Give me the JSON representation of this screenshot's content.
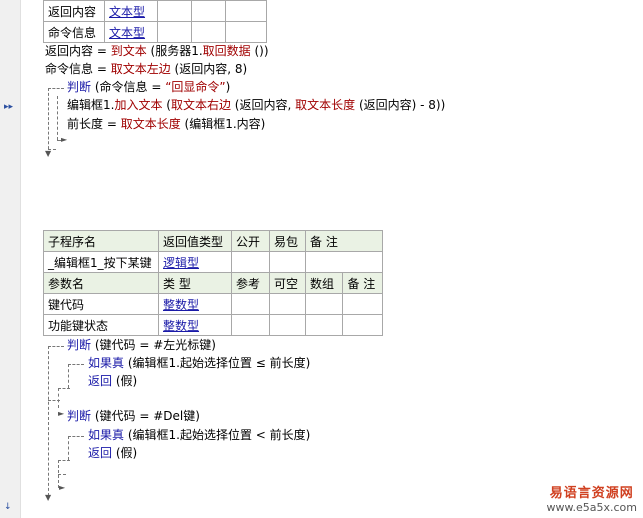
{
  "top_table": [
    {
      "name": "返回内容",
      "type": "文本型"
    },
    {
      "name": "命令信息",
      "type": "文本型"
    }
  ],
  "code1": {
    "l1": {
      "a": "返回内容 = ",
      "b": "到文本",
      "c": " (服务器1.",
      "d": "取回数据",
      "e": " ())"
    },
    "l2": {
      "a": "命令信息 = ",
      "b": "取文本左边",
      "c": " (返回内容, 8)"
    },
    "l3": {
      "a": "判断",
      "b": " (命令信息 = ",
      "c": "“回显命令”",
      "d": ")"
    },
    "l4": {
      "a": "编辑框1.",
      "b": "加入文本",
      "c": " (",
      "d": "取文本右边",
      "e": " (返回内容, ",
      "f": "取文本长度",
      "g": " (返回内容) - 8))"
    },
    "l5": {
      "a": "前长度 = ",
      "b": "取文本长度",
      "c": " (编辑框1.内容)"
    }
  },
  "sub_table": {
    "h1": [
      "子程序名",
      "返回值类型",
      "公开",
      "易包",
      "备 注"
    ],
    "r1": {
      "name": "_编辑框1_按下某键",
      "type": "逻辑型"
    },
    "h2": [
      "参数名",
      "类 型",
      "参考",
      "可空",
      "数组",
      "备 注"
    ],
    "params": [
      {
        "name": "键代码",
        "type": "整数型"
      },
      {
        "name": "功能键状态",
        "type": "整数型"
      }
    ]
  },
  "code2": {
    "j1": {
      "a": "判断",
      "b": " (键代码 = #左光标键)"
    },
    "j1a": {
      "a": "如果真",
      "b": " (编辑框1.起始选择位置 ≤ 前长度)"
    },
    "j1b": {
      "a": "返回",
      "b": " (假)"
    },
    "j2": {
      "a": "判断",
      "b": " (键代码 = #Del键)"
    },
    "j2a": {
      "a": "如果真",
      "b": " (编辑框1.起始选择位置 < 前长度)"
    },
    "j2b": {
      "a": "返回",
      "b": " (假)"
    }
  },
  "watermark": {
    "title": "易语言资源网",
    "url": "www.e5a5x.com"
  }
}
